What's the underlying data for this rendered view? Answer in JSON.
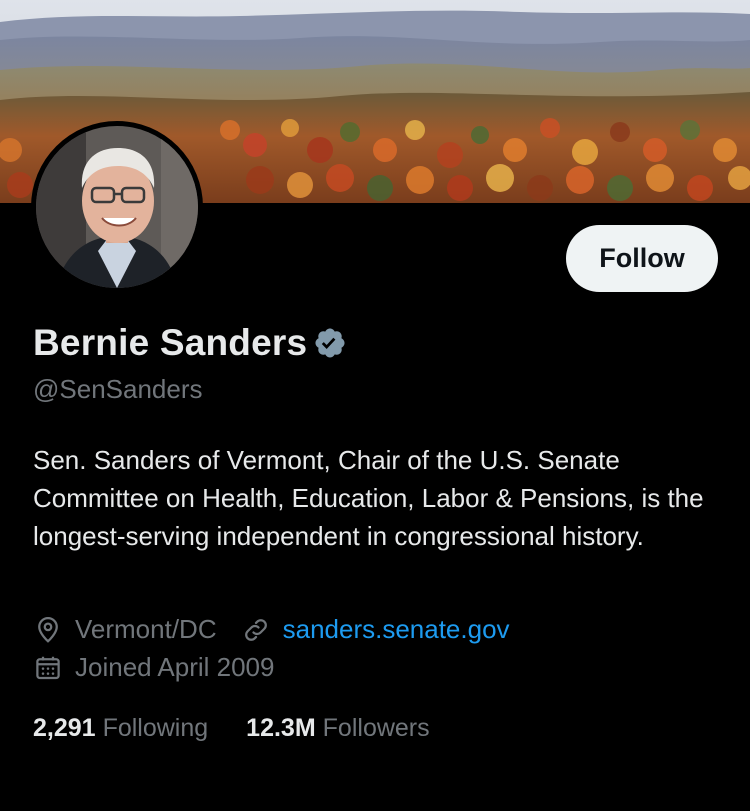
{
  "profile": {
    "name": "Bernie Sanders",
    "handle": "@SenSanders",
    "bio": "Sen. Sanders of Vermont, Chair of the U.S. Senate Committee on Health, Education, Labor & Pensions, is the longest-serving independent in congressional history.",
    "location": "Vermont/DC",
    "website": "sanders.senate.gov",
    "joined": "Joined April 2009",
    "verified_icon": "verified-badge-icon"
  },
  "actions": {
    "follow_label": "Follow"
  },
  "stats": {
    "following_count": "2,291",
    "following_label": "Following",
    "followers_count": "12.3M",
    "followers_label": "Followers"
  },
  "colors": {
    "background": "#000000",
    "text_primary": "#e7e9ea",
    "text_secondary": "#71767b",
    "link": "#1d9bf0",
    "follow_button_bg": "#eff3f4"
  }
}
